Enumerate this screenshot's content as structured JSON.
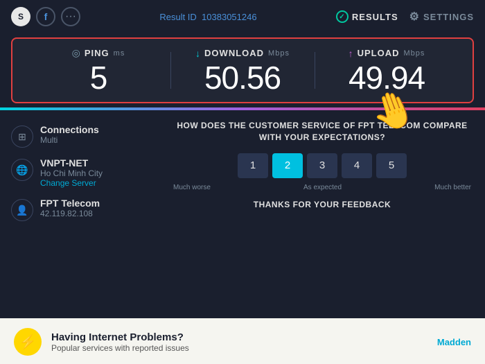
{
  "header": {
    "result_label": "Result ID",
    "result_id": "10383051246",
    "results_label": "RESULTS",
    "settings_label": "SETTINGS"
  },
  "speed": {
    "ping_label": "PING",
    "ping_unit": "ms",
    "ping_value": "5",
    "download_label": "DOWNLOAD",
    "download_unit": "Mbps",
    "download_value": "50.56",
    "upload_label": "UPLOAD",
    "upload_unit": "Mbps",
    "upload_value": "49.94"
  },
  "connection": {
    "connections_label": "Connections",
    "connections_value": "Multi",
    "isp_label": "VNPT-NET",
    "isp_city": "Ho Chi Minh City",
    "change_server_label": "Change Server",
    "provider_label": "FPT Telecom",
    "provider_ip": "42.119.82.108"
  },
  "survey": {
    "question": "HOW DOES THE CUSTOMER SERVICE OF FPT TELECOM COMPARE WITH YOUR EXPECTATIONS?",
    "options": [
      "1",
      "2",
      "3",
      "4",
      "5"
    ],
    "active_option": 1,
    "label_left": "Much worse",
    "label_center": "As expected",
    "label_right": "Much better",
    "thanks_text": "THANKS FOR YOUR FEEDBACK"
  },
  "bottom": {
    "title": "Having Internet Problems?",
    "subtitle": "Popular services with reported issues",
    "link_text": "Madden"
  }
}
